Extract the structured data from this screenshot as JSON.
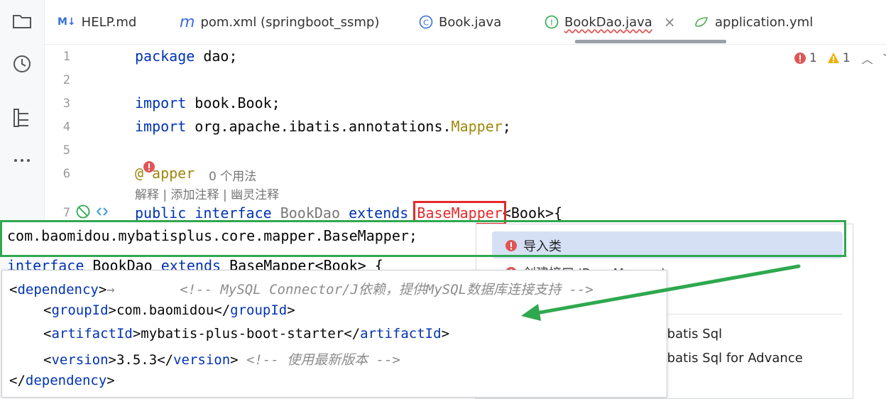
{
  "tabs": [
    {
      "label": "HELP.md",
      "icon": "markdown-icon"
    },
    {
      "label": "pom.xml (springboot_ssmp)",
      "icon": "maven-icon"
    },
    {
      "label": "Book.java",
      "icon": "class-icon"
    },
    {
      "label": "BookDao.java",
      "icon": "interface-icon",
      "active": true
    },
    {
      "label": "application.yml",
      "icon": "spring-yaml-icon"
    }
  ],
  "counter": {
    "errors": "1",
    "warnings": "1"
  },
  "line_numbers": [
    "1",
    "2",
    "3",
    "4",
    "5",
    "6",
    "7"
  ],
  "code": {
    "l1_kw": "package",
    "l1_rest": " dao;",
    "l3_kw": "import",
    "l3_rest": " book.Book;",
    "l4_kw": "import",
    "l4_rest": " org.apache.ibatis.annotations.",
    "l4_ann": "Mapper",
    "l4_end": ";",
    "l6_ann_a": "@",
    "l6_ann_b": "apper",
    "l7_kw1": "public",
    "l7_kw2": "interface",
    "l7_name": "BookDao",
    "l7_kw3": "extends",
    "l7_base": "BaseMapper",
    "l7_end": "<Book>{"
  },
  "usage_hint": "0 个用法",
  "ai_hint": "解释 | 添加注释 | 幽灵注释",
  "suggestion": "com.baomidou.mybatisplus.core.mapper.BaseMapper;",
  "hidden_line": {
    "kw1": "interface",
    "name": " BookDao ",
    "kw2": "extends",
    "rest": " BaseMapper<Book> {"
  },
  "quick_fixes": [
    "导入类",
    "创建接口 'BaseMapper'",
    "ybatis Sql",
    "ybatis Sql for Advance"
  ],
  "xml": {
    "open_dep": "dependency",
    "arrow": "→",
    "comment1": "<!-- MySQL Connector/J依赖，提供MySQL数据库连接支持 -->",
    "group_tag": "groupId",
    "group_val": "com.baomidou",
    "artifact_tag": "artifactId",
    "artifact_val": "mybatis-plus-boot-starter",
    "version_tag": "version",
    "version_val": "3.5.3",
    "comment2": "<!-- 使用最新版本 -->",
    "close_dep": "dependency"
  },
  "colors": {
    "accent_red": "#e62a2a",
    "accent_green": "#2fa84f",
    "keyword": "#0033b3",
    "annotation": "#9e880d"
  }
}
